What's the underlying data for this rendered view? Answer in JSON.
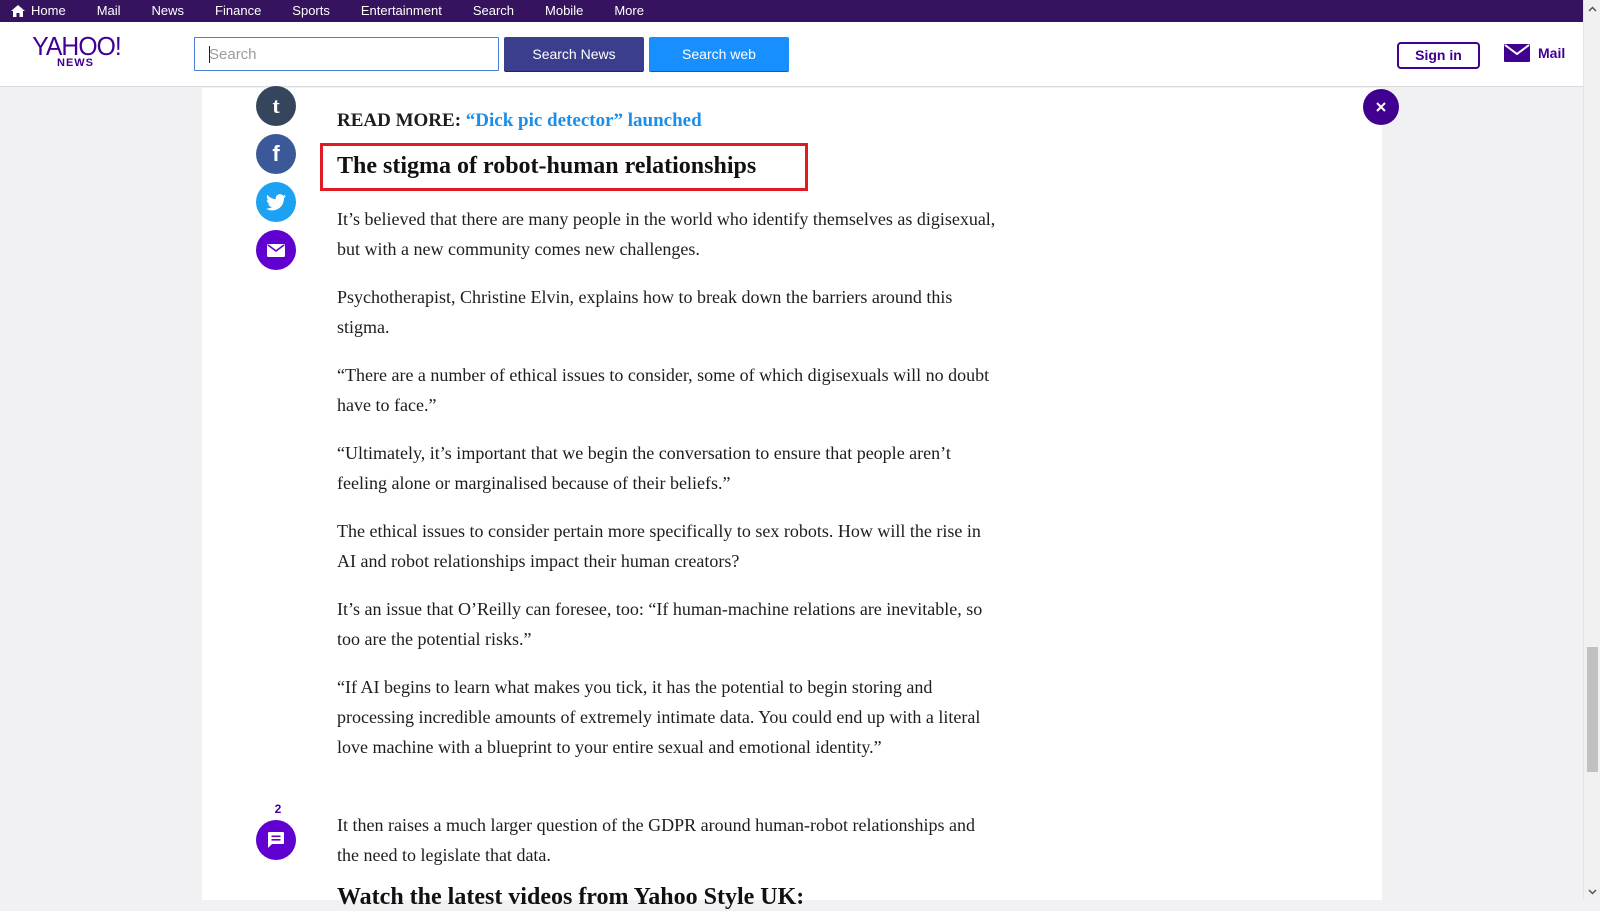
{
  "topnav": {
    "items": [
      "Home",
      "Mail",
      "News",
      "Finance",
      "Sports",
      "Entertainment",
      "Search",
      "Mobile",
      "More"
    ]
  },
  "header": {
    "logo_main": "YAHOO!",
    "logo_sub": "NEWS",
    "search_placeholder": "Search",
    "search_news_label": "Search News",
    "search_web_label": "Search web",
    "signin_label": "Sign in",
    "mail_label": "Mail"
  },
  "share": {
    "tumblr_glyph": "t",
    "facebook_glyph": "f"
  },
  "comments": {
    "count": "2"
  },
  "article": {
    "read_more_prefix": "READ MORE:",
    "read_more_link": "“Dick pic detector” launched",
    "subhead": "The stigma of robot-human relationships",
    "paragraphs": [
      "It’s believed that there are many people in the world who identify themselves as digisexual, but with a new community comes new challenges.",
      "Psychotherapist, Christine Elvin, explains how to break down the barriers around this stigma.",
      "“There are a number of ethical issues to consider, some of which digisexuals will no doubt have to face.”",
      "“Ultimately, it’s important that we begin the conversation to ensure that people aren’t feeling alone or marginalised because of their beliefs.”",
      "The ethical issues to consider pertain more specifically to sex robots. How will the rise in AI and robot relationships impact their human creators?",
      "It’s an issue that O’Reilly can foresee, too: “If human-machine relations are inevitable, so too are the potential risks.”",
      "“If AI begins to learn what makes you tick, it has the potential to begin storing and processing incredible amounts of extremely intimate data. You could end up with a literal love machine with a blueprint to your entire sexual and emotional identity.”",
      "It then raises a much larger question of the GDPR around human-robot relationships and the need to legislate that data."
    ],
    "video_heading": "Watch the latest videos from Yahoo Style UK:"
  },
  "colors": {
    "brand_purple": "#400090",
    "nav_bg": "#35135e",
    "highlight_red": "#e01b24",
    "link_blue": "#1a8ee8"
  }
}
